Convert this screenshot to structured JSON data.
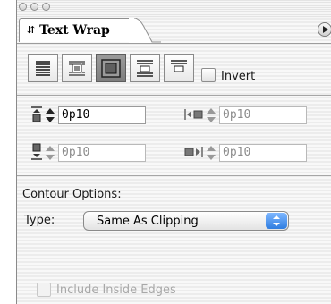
{
  "panel": {
    "tab_label": "Text Wrap",
    "invert_label": "Invert",
    "offsets": {
      "top": "0p10",
      "bottom": "0p10",
      "left": "0p10",
      "right": "0p10"
    },
    "contour_heading": "Contour Options:",
    "type_label": "Type:",
    "type_value": "Same As Clipping",
    "include_inside_edges_label": "Include Inside Edges"
  }
}
